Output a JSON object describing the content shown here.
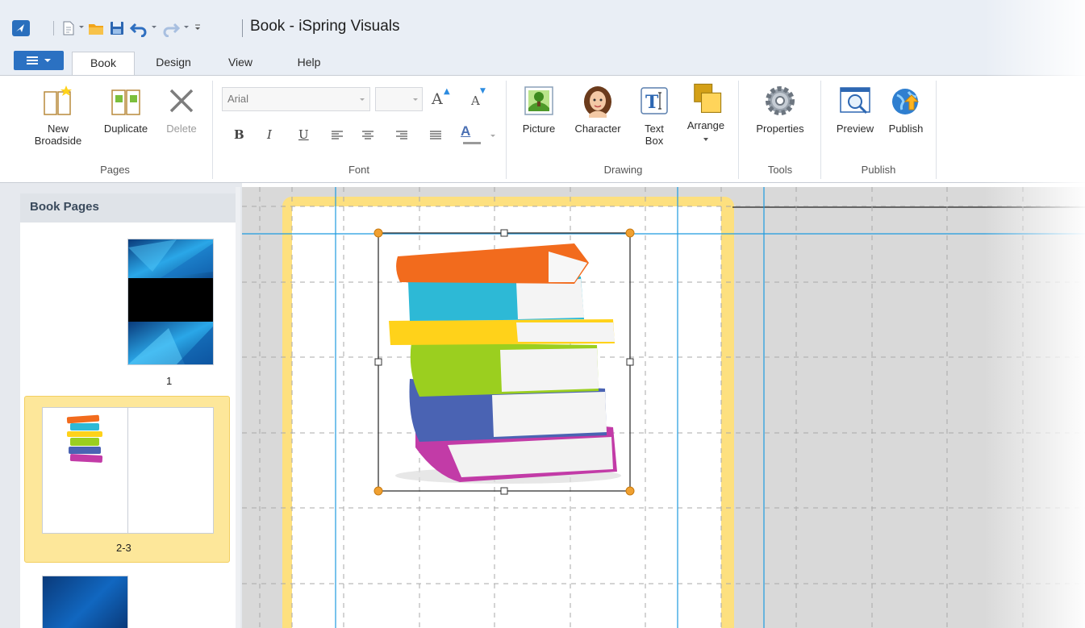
{
  "window": {
    "title": "Book - iSpring Visuals"
  },
  "tabs": [
    {
      "label": "Book",
      "active": true
    },
    {
      "label": "Design",
      "active": false
    },
    {
      "label": "View",
      "active": false
    },
    {
      "label": "Help",
      "active": false
    }
  ],
  "ribbon": {
    "pages": {
      "label": "Pages",
      "new_broadside_line1": "New",
      "new_broadside_line2": "Broadside",
      "duplicate": "Duplicate",
      "delete": "Delete"
    },
    "font": {
      "label": "Font",
      "family": "Arial",
      "size": "",
      "bold": "B",
      "italic": "I",
      "underline": "U",
      "grow_glyph": "A",
      "shrink_glyph": "A",
      "color_glyph": "A"
    },
    "drawing": {
      "label": "Drawing",
      "picture": "Picture",
      "character": "Character",
      "text_box_line1": "Text",
      "text_box_line2": "Box",
      "arrange": "Arrange"
    },
    "tools": {
      "label": "Tools",
      "properties": "Properties"
    },
    "publish": {
      "label": "Publish",
      "preview": "Preview",
      "publish": "Publish"
    }
  },
  "left_panel": {
    "title": "Book Pages",
    "pages": [
      {
        "label": "1",
        "selected": false
      },
      {
        "label": "2-3",
        "selected": true
      },
      {
        "label": "",
        "selected": false
      }
    ]
  },
  "colors": {
    "accent": "#2b71c2",
    "selection": "#fde79a",
    "page_frame": "#fde07f",
    "guide": "#1e9be0"
  }
}
